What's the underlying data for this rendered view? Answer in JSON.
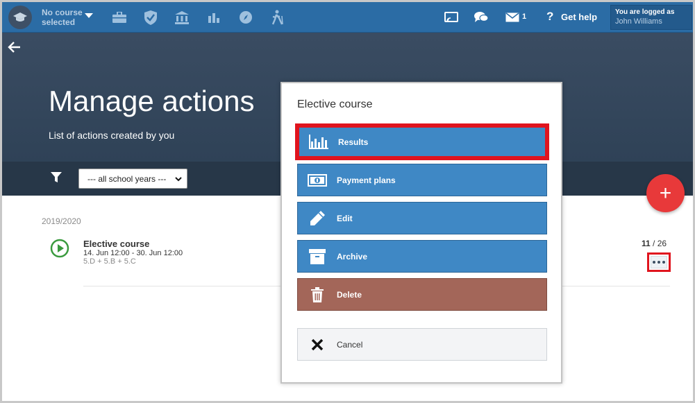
{
  "topbar": {
    "course_selector": "No course selected",
    "message_count": "1",
    "help_label": "Get help",
    "user": {
      "logged_as_label": "You are logged as",
      "name": "John Williams"
    }
  },
  "page": {
    "title": "Manage actions",
    "subtitle": "List of actions created by you"
  },
  "filter": {
    "school_year_value": "--- all school years ---"
  },
  "list": {
    "year_group": "2019/2020",
    "items": [
      {
        "title": "Elective course",
        "dates": "14. Jun 12:00 - 30. Jun 12:00",
        "classes": "5.D + 5.B + 5.C",
        "count_done": "11",
        "count_sep": "/",
        "count_total": "26"
      }
    ]
  },
  "fab": {
    "label": "+"
  },
  "modal": {
    "title": "Elective course",
    "buttons": {
      "results": "Results",
      "payment_plans": "Payment plans",
      "edit": "Edit",
      "archive": "Archive",
      "delete": "Delete",
      "cancel": "Cancel"
    }
  },
  "colors": {
    "topbar": "#2b6ca5",
    "hero": "#34465b",
    "button_blue": "#3f88c5",
    "button_delete": "#a36659",
    "highlight": "#e0141e",
    "fab": "#e8393a"
  }
}
